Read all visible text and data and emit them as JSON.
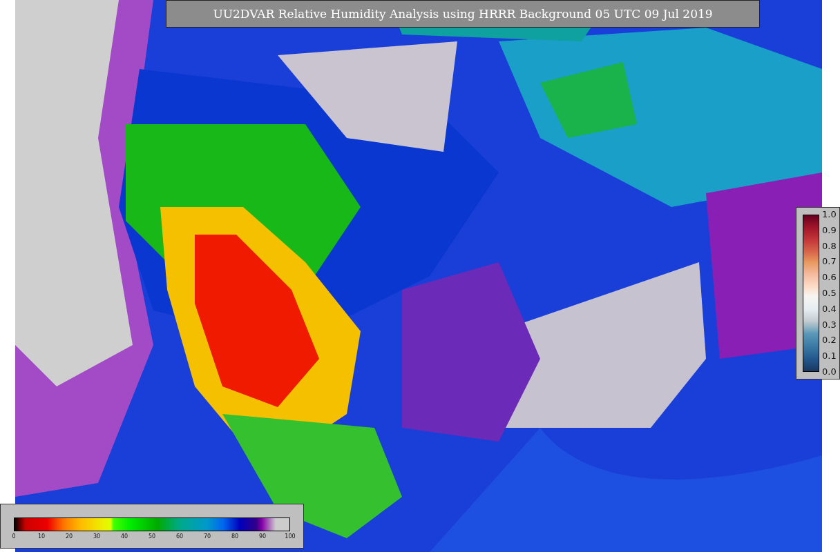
{
  "title": "UU2DVAR Relative Humidity Analysis using HRRR Background 05 UTC 09 Jul 2019",
  "humidity_colorbar": {
    "ticks": [
      "0",
      "10",
      "20",
      "30",
      "40",
      "50",
      "60",
      "70",
      "80",
      "90",
      "100"
    ]
  },
  "station_colorbar": {
    "ticks": [
      "1.0",
      "0.9",
      "0.8",
      "0.7",
      "0.6",
      "0.5",
      "0.4",
      "0.3",
      "0.2",
      "0.1",
      "0.0"
    ]
  }
}
